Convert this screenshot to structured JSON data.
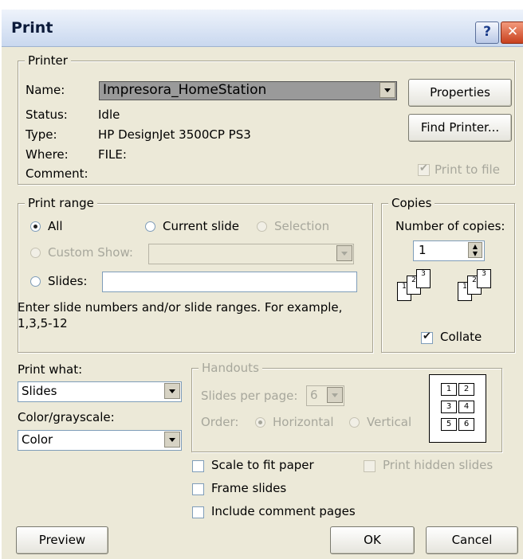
{
  "window": {
    "title": "Print",
    "help_glyph": "?",
    "close_glyph": "✕"
  },
  "printer": {
    "legend": "Printer",
    "name_label": "Name:",
    "name_value": "Impresora_HomeStation",
    "status_label": "Status:",
    "status_value": "Idle",
    "type_label": "Type:",
    "type_value": "HP DesignJet 3500CP PS3",
    "where_label": "Where:",
    "where_value": "FILE:",
    "comment_label": "Comment:",
    "properties_button": "Properties",
    "find_printer_button": "Find Printer...",
    "print_to_file_label": "Print to file",
    "print_to_file_checked": true
  },
  "print_range": {
    "legend": "Print range",
    "all_label": "All",
    "current_slide_label": "Current slide",
    "selection_label": "Selection",
    "custom_show_label": "Custom Show:",
    "slides_label": "Slides:",
    "slides_value": "",
    "hint": "Enter slide numbers and/or slide ranges. For example,",
    "hint_example": "1,3,5-12",
    "selected": "All"
  },
  "copies": {
    "legend": "Copies",
    "number_label": "Number of copies:",
    "number_value": "1",
    "collate_label": "Collate",
    "collate_checked": true,
    "collate_page_numbers": [
      "1",
      "2",
      "3"
    ]
  },
  "print_what": {
    "label": "Print what:",
    "value": "Slides"
  },
  "color": {
    "label": "Color/grayscale:",
    "value": "Color"
  },
  "handouts": {
    "legend": "Handouts",
    "slides_per_page_label": "Slides per page:",
    "slides_per_page_value": "6",
    "order_label": "Order:",
    "horizontal_label": "Horizontal",
    "vertical_label": "Vertical",
    "order_selected": "Horizontal",
    "preview_numbers": [
      "1",
      "2",
      "3",
      "4",
      "5",
      "6"
    ]
  },
  "options": {
    "scale_to_fit_label": "Scale to fit paper",
    "frame_slides_label": "Frame slides",
    "include_comments_label": "Include comment pages",
    "print_hidden_label": "Print hidden slides"
  },
  "buttons": {
    "preview": "Preview",
    "ok": "OK",
    "cancel": "Cancel"
  }
}
